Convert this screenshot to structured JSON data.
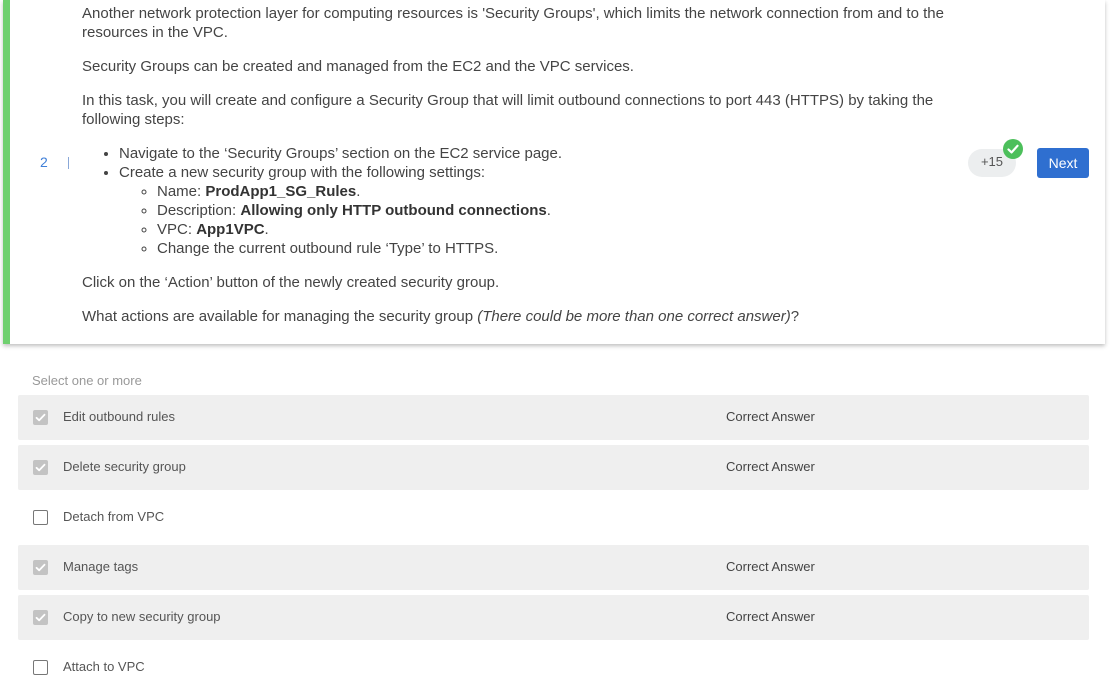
{
  "question": {
    "step_number": "2",
    "paragraphs": {
      "p1": "Another network protection layer for computing resources is 'Security Groups', which limits the network connection from and to the resources in the VPC.",
      "p2": "Security Groups can be created and managed from the EC2 and the VPC services.",
      "p3": "In this task, you will create and configure a Security Group that will limit outbound connections to port 443 (HTTPS) by taking the following steps:"
    },
    "steps": {
      "s1": "Navigate to the ‘Security Groups’ section on the EC2 service page.",
      "s2": "Create a new security group with the following settings:"
    },
    "settings": {
      "name_label": "Name: ",
      "name_value": "ProdApp1_SG_Rules",
      "desc_label": "Description: ",
      "desc_value": "Allowing only HTTP outbound connections",
      "vpc_label": "VPC: ",
      "vpc_value": "App1VPC",
      "rule_change": "Change the current outbound rule ‘Type’ to HTTPS.",
      "period": "."
    },
    "action_text": "Click on the ‘Action’ button of the newly created security group.",
    "prompt": {
      "text": "What actions are available for managing the security group ",
      "note": "(There could be more than one correct answer)",
      "end": "?"
    },
    "points": "+15",
    "next_label": "Next"
  },
  "answers": {
    "hint": "Select one or more",
    "options": [
      {
        "label": "Edit outbound rules",
        "checked": true,
        "tag": "Correct Answer"
      },
      {
        "label": "Delete security group",
        "checked": true,
        "tag": "Correct Answer"
      },
      {
        "label": "Detach from VPC",
        "checked": false,
        "tag": ""
      },
      {
        "label": "Manage tags",
        "checked": true,
        "tag": "Correct Answer"
      },
      {
        "label": "Copy to new security group",
        "checked": true,
        "tag": "Correct Answer"
      },
      {
        "label": "Attach to VPC",
        "checked": false,
        "tag": ""
      }
    ]
  },
  "colors": {
    "accent_bar": "#6fd06f",
    "primary_button": "#2f6fd0",
    "success_check": "#4cbf5b"
  },
  "icons": {
    "check": "check-circle-icon",
    "checkbox_checked": "checkbox-checked-icon",
    "checkbox_empty": "checkbox-empty-icon"
  }
}
